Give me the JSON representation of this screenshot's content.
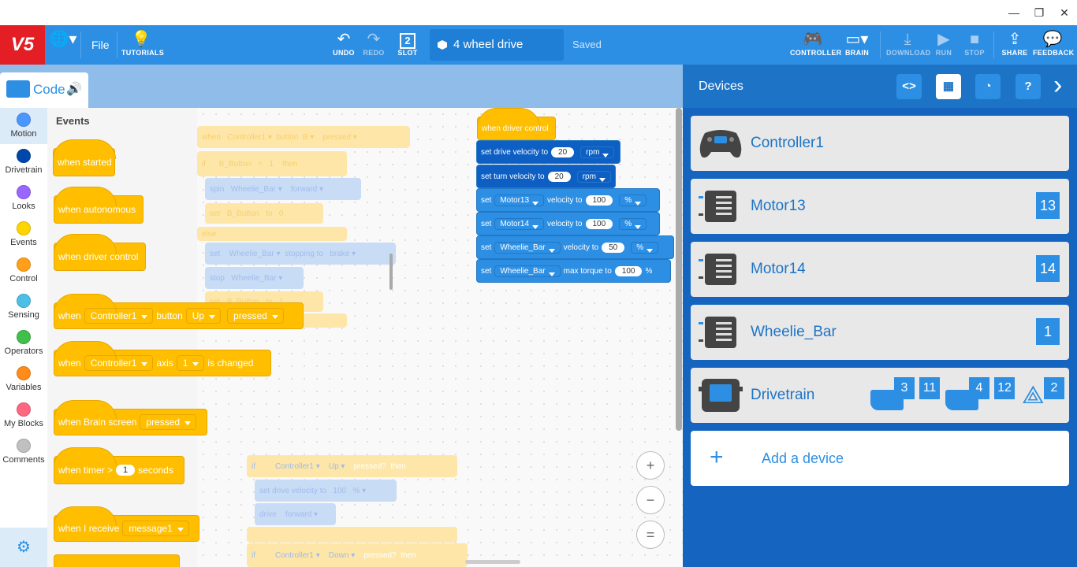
{
  "window": {
    "minimize": "—",
    "restore": "❐",
    "close": "✕"
  },
  "toolbar": {
    "logo": "V5",
    "file": "File",
    "tutorials": "TUTORIALS",
    "undo": "UNDO",
    "redo": "REDO",
    "slot_number": "2",
    "slot": "SLOT",
    "project_name": "4 wheel drive",
    "saved": "Saved",
    "controller": "CONTROLLER",
    "brain": "BRAIN",
    "download": "DOWNLOAD",
    "run": "RUN",
    "stop": "STOP",
    "share": "SHARE",
    "feedback": "FEEDBACK"
  },
  "code_tab": {
    "label": "Code"
  },
  "categories": [
    {
      "label": "Motion",
      "color": "#4c97ff"
    },
    {
      "label": "Drivetrain",
      "color": "#0047ab"
    },
    {
      "label": "Looks",
      "color": "#9966ff"
    },
    {
      "label": "Events",
      "color": "#ffd500"
    },
    {
      "label": "Control",
      "color": "#ff9f1a"
    },
    {
      "label": "Sensing",
      "color": "#4cbfe6"
    },
    {
      "label": "Operators",
      "color": "#40bf4a"
    },
    {
      "label": "Variables",
      "color": "#ff8c1a"
    },
    {
      "label": "My Blocks",
      "color": "#ff6680"
    },
    {
      "label": "Comments",
      "color": "#c0c0c0"
    }
  ],
  "palette": {
    "title": "Events",
    "when_started": "when started",
    "when_autonomous": "when autonomous",
    "when_driver_control": "when driver control",
    "button_block": {
      "when": "when",
      "controller": "Controller1",
      "button": "button",
      "key": "Up",
      "state": "pressed"
    },
    "axis_block": {
      "when": "when",
      "controller": "Controller1",
      "axis": "axis",
      "num": "1",
      "changed": "is changed"
    },
    "brain_block": {
      "text": "when Brain screen",
      "state": "pressed"
    },
    "timer_block": {
      "text": "when timer >",
      "value": "1",
      "unit": "seconds"
    },
    "receive_block": {
      "text": "when I receive",
      "message": "message1"
    }
  },
  "script": {
    "hat": "when driver control",
    "drive_velocity": {
      "text": "set drive velocity to",
      "value": "20",
      "unit": "rpm"
    },
    "turn_velocity": {
      "text": "set turn velocity to",
      "value": "20",
      "unit": "rpm"
    },
    "motor13": {
      "set": "set",
      "motor": "Motor13",
      "text": "velocity to",
      "value": "100",
      "unit": "%"
    },
    "motor14": {
      "set": "set",
      "motor": "Motor14",
      "text": "velocity to",
      "value": "100",
      "unit": "%"
    },
    "wheelie_vel": {
      "set": "set",
      "motor": "Wheelie_Bar",
      "text": "velocity to",
      "value": "50",
      "unit": "%"
    },
    "wheelie_torque": {
      "set": "set",
      "motor": "Wheelie_Bar",
      "text": "max torque to",
      "value": "100",
      "unit": "%"
    }
  },
  "faded": {
    "when": "when",
    "controller1": "Controller1",
    "button": "button",
    "b": "B",
    "pressed": "pressed",
    "if": "if",
    "b_button": "B_Button",
    "eq": "=",
    "one": "1",
    "then": "then",
    "spin": "spin",
    "wheelie_bar": "Wheelie_Bar",
    "forward": "forward",
    "set": "set",
    "to": "to",
    "zero": "0",
    "else": "else",
    "stopping_to": "stopping to",
    "brake": "brake",
    "stop": "stop",
    "up": "Up",
    "pressed_q": "pressed?",
    "set_drive_vel": "set drive velocity to",
    "hundred": "100",
    "pct": "%",
    "drive": "drive",
    "down": "Down"
  },
  "zoom": {
    "in": "+",
    "out": "−",
    "reset": "="
  },
  "devices": {
    "title": "Devices",
    "items": [
      {
        "name": "Controller1",
        "ports": []
      },
      {
        "name": "Motor13",
        "ports": [
          "13"
        ]
      },
      {
        "name": "Motor14",
        "ports": [
          "14"
        ]
      },
      {
        "name": "Wheelie_Bar",
        "ports": [
          "1"
        ]
      },
      {
        "name": "Drivetrain",
        "ports": [
          "3",
          "11",
          "4",
          "12",
          "2"
        ]
      }
    ],
    "add": "Add a device"
  }
}
